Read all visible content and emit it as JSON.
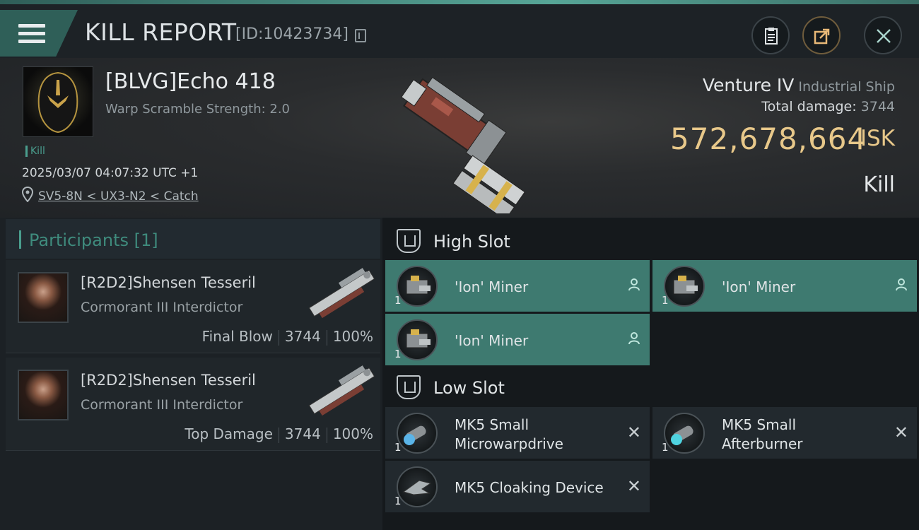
{
  "header": {
    "title": "KILL REPORT",
    "report_id": "[ID:10423734]"
  },
  "victim": {
    "name": "[BLVG]Echo 418",
    "warp_scramble": "Warp Scramble Strength: 2.0",
    "kill_tag": "Kill",
    "datetime": "2025/03/07 04:07:32 UTC +1",
    "location": "SV5-8N < UX3-N2 < Catch",
    "ship": "Venture IV",
    "ship_class": "Industrial Ship",
    "total_damage_label": "Total damage:",
    "total_damage": "3744",
    "isk_value": "572,678,664",
    "isk_unit": "ISK",
    "result": "Kill"
  },
  "participants": {
    "header": "Participants [1]",
    "rows": [
      {
        "name": "[R2D2]Shensen Tesseril",
        "ship": "Cormorant III Interdictor",
        "role": "Final Blow",
        "damage": "3744",
        "percent": "100%"
      },
      {
        "name": "[R2D2]Shensen Tesseril",
        "ship": "Cormorant III Interdictor",
        "role": "Top Damage",
        "damage": "3744",
        "percent": "100%"
      }
    ]
  },
  "slots": {
    "high": {
      "title": "High Slot",
      "modules": [
        {
          "name": "'Ion' Miner",
          "qty": "1"
        },
        {
          "name": "'Ion' Miner",
          "qty": "1"
        },
        {
          "name": "'Ion' Miner",
          "qty": "1"
        }
      ]
    },
    "low": {
      "title": "Low Slot",
      "modules": [
        {
          "name": "MK5 Small Microwarpdrive",
          "line1": "MK5 Small",
          "line2": "Microwarpdrive",
          "qty": "1"
        },
        {
          "name": "MK5 Small Afterburner",
          "line1": "MK5 Small",
          "line2": "Afterburner",
          "qty": "1"
        },
        {
          "name": "MK5 Cloaking Device",
          "qty": "1"
        }
      ]
    }
  },
  "colors": {
    "accent": "#4a9e8e",
    "fitted": "#3e7a70",
    "isk": "#e8c88a"
  }
}
